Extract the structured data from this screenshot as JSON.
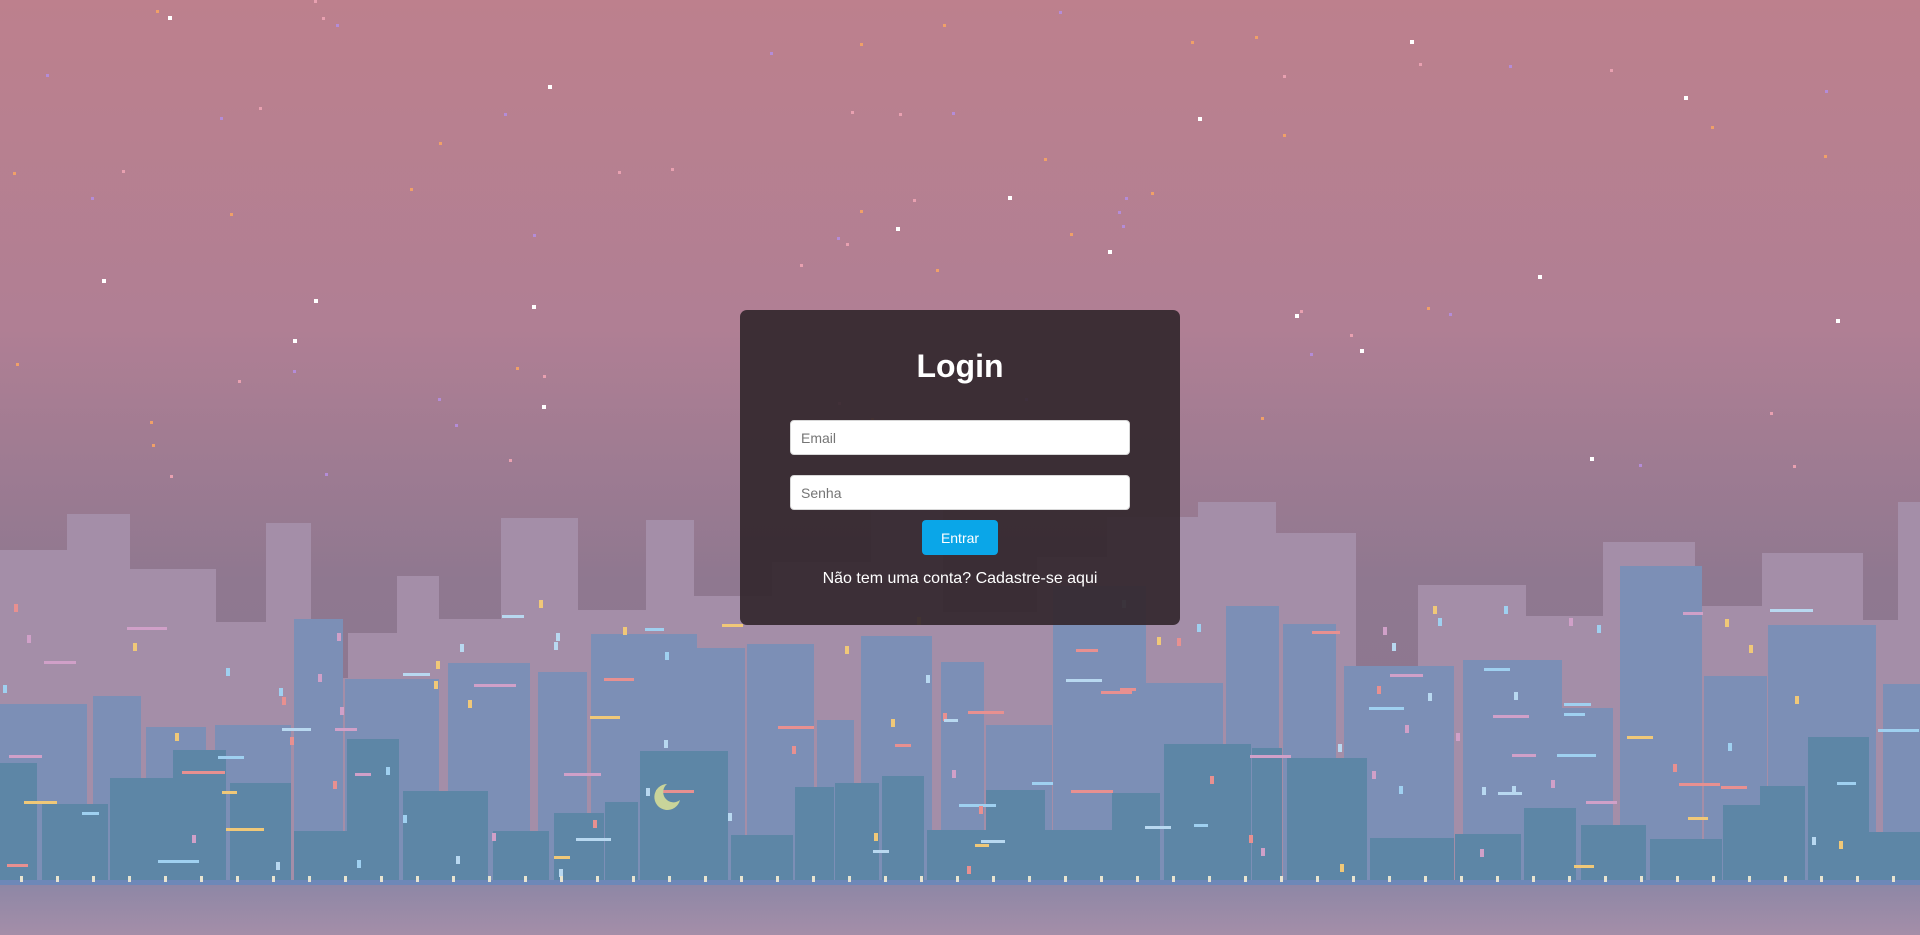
{
  "colors": {
    "sky_top": "#bd808d",
    "sky_bottom": "#8f7890",
    "skyline_far": "#a48ea8",
    "skyline_mid": "#7c8fb6",
    "skyline_near": "#5d86a6",
    "water": "#9a8fa8",
    "card_bg": "#34282e",
    "button_bg": "#0aa6e8",
    "text": "#ffffff"
  },
  "login": {
    "title": "Login",
    "email_placeholder": "Email",
    "password_placeholder": "Senha",
    "submit_label": "Entrar",
    "signup_prompt": "Não tem uma conta?",
    "signup_link": "Cadastre-se aqui"
  }
}
